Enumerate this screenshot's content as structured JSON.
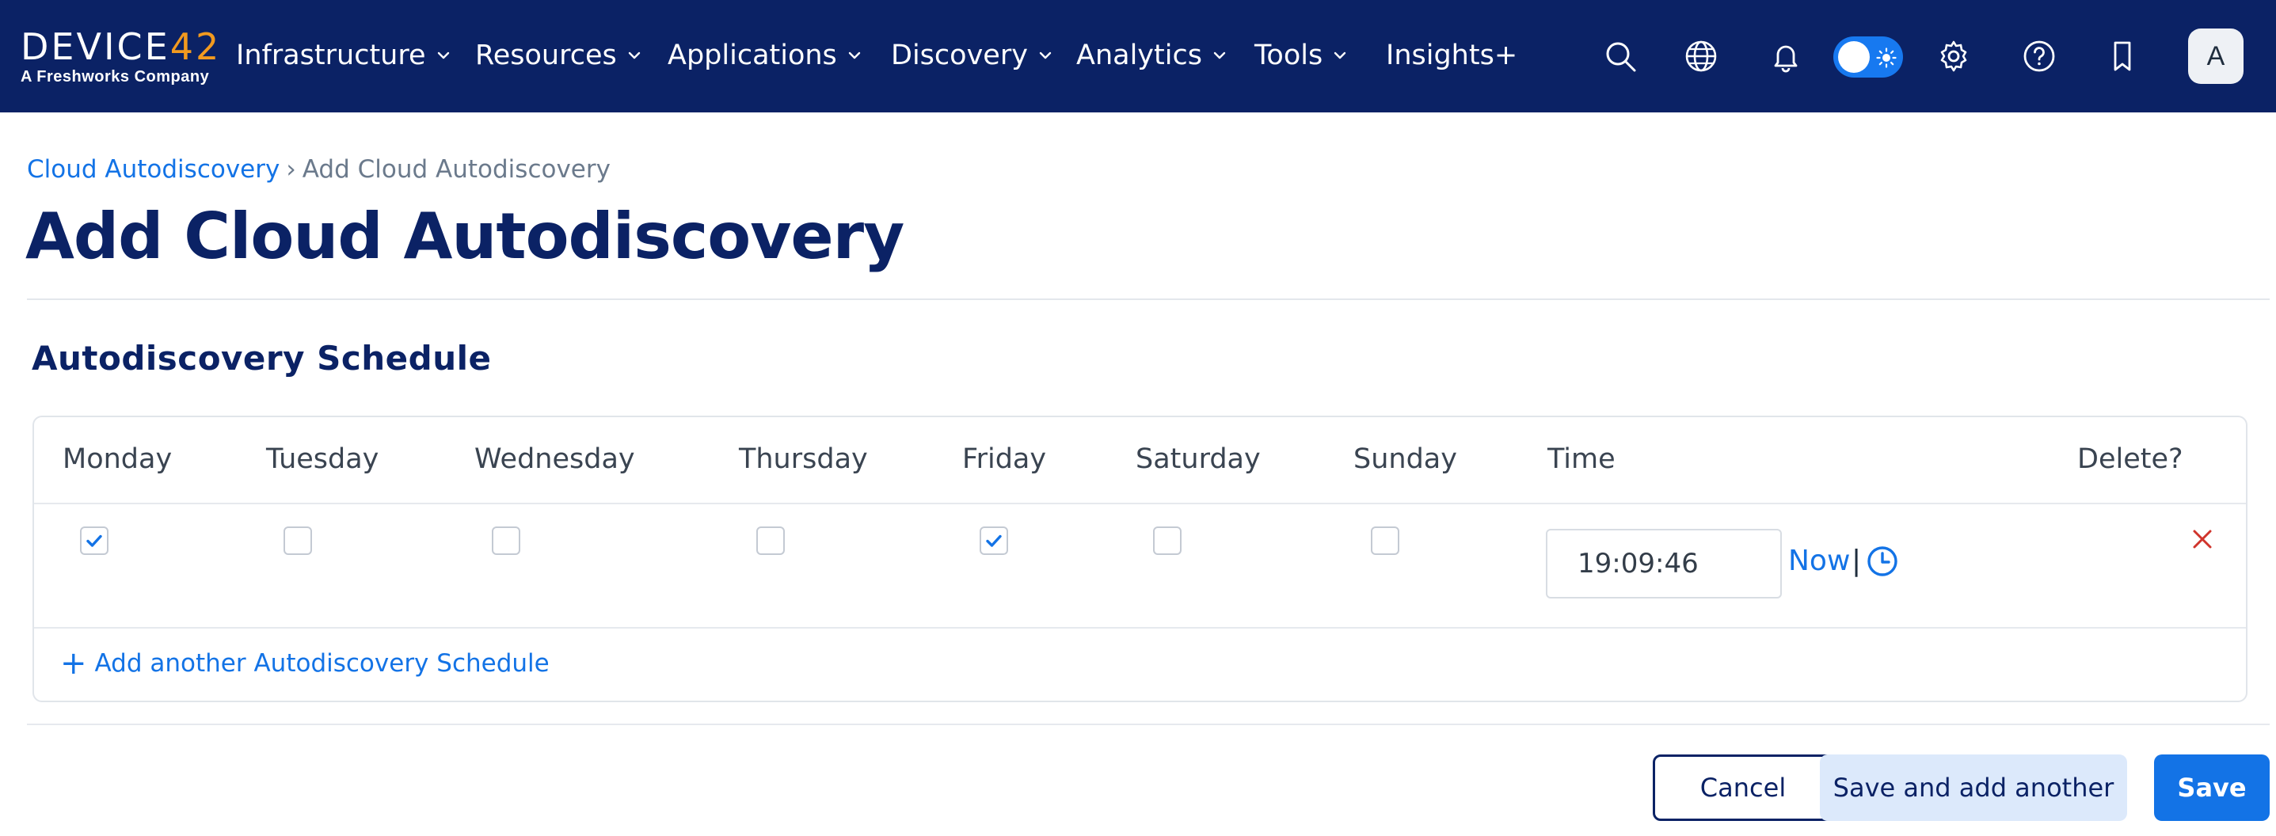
{
  "brand": {
    "logo_main": "DEVICE",
    "logo_num": "42",
    "logo_sub": "A Freshworks Company"
  },
  "nav": {
    "items": [
      {
        "label": "Infrastructure",
        "has_dropdown": true
      },
      {
        "label": "Resources",
        "has_dropdown": true
      },
      {
        "label": "Applications",
        "has_dropdown": true
      },
      {
        "label": "Discovery",
        "has_dropdown": true
      },
      {
        "label": "Analytics",
        "has_dropdown": true
      },
      {
        "label": "Tools",
        "has_dropdown": true
      },
      {
        "label": "Insights+",
        "has_dropdown": false
      }
    ],
    "icons": [
      "search-icon",
      "globe-icon",
      "bell-icon",
      "theme-toggle",
      "gear-icon",
      "help-icon",
      "bookmark-icon"
    ],
    "avatar_initial": "A"
  },
  "breadcrumb": {
    "parent": "Cloud Autodiscovery",
    "separator": "›",
    "current": "Add Cloud Autodiscovery"
  },
  "page_title": "Add Cloud Autodiscovery",
  "schedule": {
    "section_title": "Autodiscovery Schedule",
    "columns": [
      "Monday",
      "Tuesday",
      "Wednesday",
      "Thursday",
      "Friday",
      "Saturday",
      "Sunday",
      "Time",
      "Delete?"
    ],
    "rows": [
      {
        "days": {
          "Monday": true,
          "Tuesday": false,
          "Wednesday": false,
          "Thursday": false,
          "Friday": true,
          "Saturday": false,
          "Sunday": false
        },
        "time": "19:09:46"
      }
    ],
    "now_label": "Now",
    "pipe": "|",
    "add_label": "Add another Autodiscovery Schedule",
    "add_plus": "+"
  },
  "actions": {
    "cancel": "Cancel",
    "save_and_add": "Save and add another",
    "save": "Save"
  },
  "colors": {
    "nav_bg": "#0b2265",
    "accent": "#1373e6",
    "logo_accent": "#f29a1f",
    "delete": "#d0342c"
  }
}
